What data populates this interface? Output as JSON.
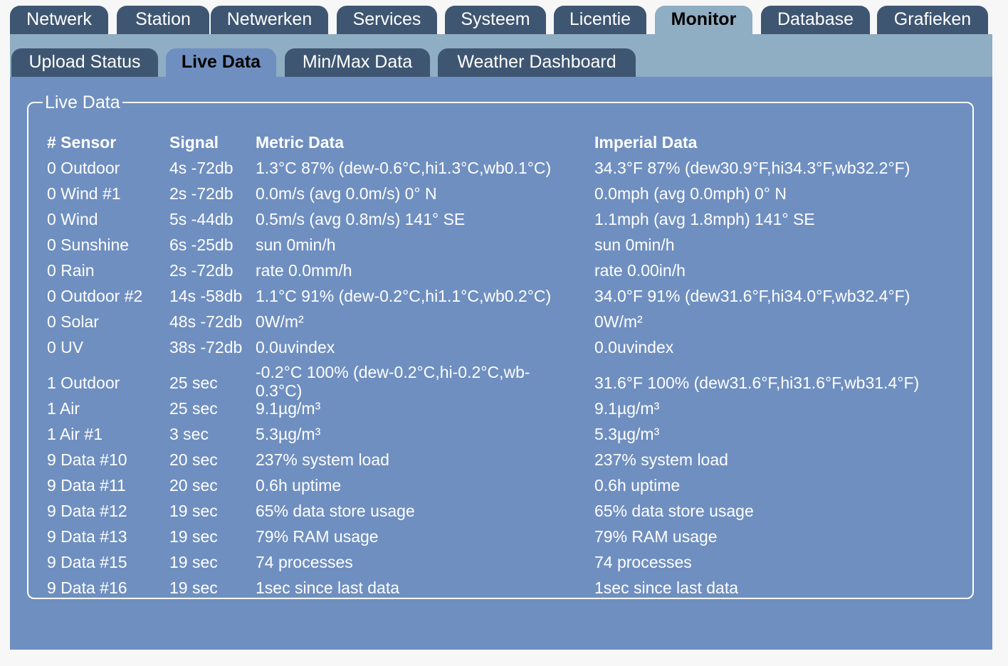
{
  "tabs": [
    "Netwerk",
    "Station",
    "Netwerken",
    "Services",
    "Systeem",
    "Licentie",
    "Monitor",
    "Database",
    "Grafieken"
  ],
  "subtabs": [
    "Upload Status",
    "Live Data",
    "Min/Max Data",
    "Weather Dashboard"
  ],
  "panel": {
    "legend": "Live Data",
    "headers": [
      "# Sensor",
      "Signal",
      "Metric Data",
      "Imperial Data"
    ],
    "rows": [
      [
        "0 Outdoor",
        "4s -72db",
        "1.3°C 87% (dew-0.6°C,hi1.3°C,wb0.1°C)",
        "34.3°F 87% (dew30.9°F,hi34.3°F,wb32.2°F)"
      ],
      [
        "0 Wind #1",
        "2s -72db",
        "0.0m/s (avg 0.0m/s) 0° N",
        "0.0mph (avg 0.0mph) 0° N"
      ],
      [
        "0 Wind",
        "5s -44db",
        "0.5m/s (avg 0.8m/s) 141° SE",
        "1.1mph (avg 1.8mph) 141° SE"
      ],
      [
        "0 Sunshine",
        "6s -25db",
        "sun 0min/h",
        "sun 0min/h"
      ],
      [
        "0 Rain",
        "2s -72db",
        "rate 0.0mm/h",
        "rate 0.00in/h"
      ],
      [
        "0 Outdoor #2",
        "14s -58db",
        "1.1°C 91% (dew-0.2°C,hi1.1°C,wb0.2°C)",
        "34.0°F 91% (dew31.6°F,hi34.0°F,wb32.4°F)"
      ],
      [
        "0 Solar",
        "48s -72db",
        "0W/m²",
        "0W/m²"
      ],
      [
        "0 UV",
        "38s -72db",
        "0.0uvindex",
        "0.0uvindex"
      ],
      [
        "1 Outdoor",
        "25 sec",
        "-0.2°C 100% (dew-0.2°C,hi-0.2°C,wb-0.3°C)",
        "31.6°F 100% (dew31.6°F,hi31.6°F,wb31.4°F)"
      ],
      [
        "1 Air",
        "25 sec",
        "9.1µg/m³",
        "9.1µg/m³"
      ],
      [
        "1 Air #1",
        "3 sec",
        "5.3µg/m³",
        "5.3µg/m³"
      ],
      [
        "9 Data #10",
        "20 sec",
        "237% system load",
        "237% system load"
      ],
      [
        "9 Data #11",
        "20 sec",
        "0.6h uptime",
        "0.6h uptime"
      ],
      [
        "9 Data #12",
        "19 sec",
        "65% data store usage",
        "65% data store usage"
      ],
      [
        "9 Data #13",
        "19 sec",
        "79% RAM usage",
        "79% RAM usage"
      ],
      [
        "9 Data #15",
        "19 sec",
        "74 processes",
        "74 processes"
      ],
      [
        "9 Data #16",
        "19 sec",
        "1sec since last data",
        "1sec since last data"
      ]
    ]
  }
}
